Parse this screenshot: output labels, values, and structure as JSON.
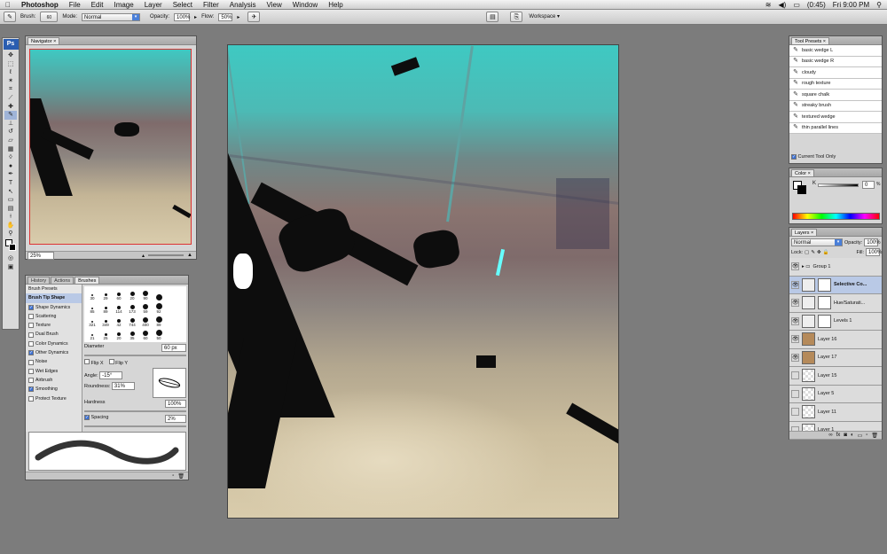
{
  "menubar": {
    "apple": "",
    "app": "Photoshop",
    "items": [
      "File",
      "Edit",
      "Image",
      "Layer",
      "Select",
      "Filter",
      "Analysis",
      "View",
      "Window",
      "Help"
    ],
    "battery": "(0:45)",
    "clock": "Fri 9:00 PM"
  },
  "options": {
    "brush_label": "Brush:",
    "brush_size": "60",
    "mode_label": "Mode:",
    "mode_value": "Normal",
    "opacity_label": "Opacity:",
    "opacity_value": "100%",
    "flow_label": "Flow:",
    "flow_value": "50%",
    "workspace": "Workspace"
  },
  "navigator": {
    "tab": "Navigator",
    "zoom": "25%"
  },
  "brushes_panel": {
    "tabs": [
      "History",
      "Actions",
      "Brushes"
    ],
    "list": [
      "Brush Presets",
      "Brush Tip Shape",
      "Shape Dynamics",
      "Scattering",
      "Texture",
      "Dual Brush",
      "Color Dynamics",
      "Other Dynamics",
      "Noise",
      "Wet Edges",
      "Airbrush",
      "Smoothing",
      "Protect Texture"
    ],
    "checked": [
      false,
      false,
      true,
      false,
      false,
      false,
      false,
      true,
      false,
      false,
      false,
      true,
      false
    ],
    "tips": [
      "30",
      "29",
      "60",
      "20",
      "90",
      "",
      "85",
      "89",
      "114",
      "173",
      "59",
      "92",
      "321",
      "349",
      "42",
      "744",
      "400",
      "89",
      "21",
      "25",
      "20",
      "35",
      "60",
      "50"
    ],
    "diameter_label": "Diameter",
    "diameter_value": "60 px",
    "flipx": "Flip X",
    "flipy": "Flip Y",
    "angle_label": "Angle:",
    "angle_value": "-15°",
    "roundness_label": "Roundness:",
    "roundness_value": "31%",
    "hardness_label": "Hardness",
    "hardness_value": "100%",
    "spacing_label": "Spacing",
    "spacing_value": "2%"
  },
  "tool_presets": {
    "tab": "Tool Presets",
    "items": [
      "basic wedge L",
      "basic wedge R",
      "cloudy",
      "rough texture",
      "square chalk",
      "streaky brush",
      "textured wedge",
      "thin parallel lines"
    ],
    "current_only": "Current Tool Only"
  },
  "color": {
    "tab": "Color",
    "k_label": "K",
    "k_value": "0",
    "pct": "%"
  },
  "layers": {
    "tab": "Layers",
    "blend": "Normal",
    "opacity_label": "Opacity:",
    "opacity_value": "100%",
    "lock_label": "Lock:",
    "fill_label": "Fill:",
    "fill_value": "100%",
    "rows": [
      {
        "name": "Group 1",
        "visible": true,
        "group": true
      },
      {
        "name": "Selective Co...",
        "visible": true,
        "adj": true,
        "selected": true
      },
      {
        "name": "Hue/Saturati...",
        "visible": true,
        "adj": true
      },
      {
        "name": "Levels 1",
        "visible": true,
        "adj": true
      },
      {
        "name": "Layer 16",
        "visible": true
      },
      {
        "name": "Layer 17",
        "visible": true
      },
      {
        "name": "Layer 15",
        "visible": false
      },
      {
        "name": "Layer 5",
        "visible": false
      },
      {
        "name": "Layer 11",
        "visible": false
      },
      {
        "name": "Layer 1",
        "visible": false
      }
    ]
  },
  "colors": {
    "accent": "#3b6fd1",
    "panel": "#d6d6d6",
    "canvas_bg": "#7c7c7c"
  }
}
